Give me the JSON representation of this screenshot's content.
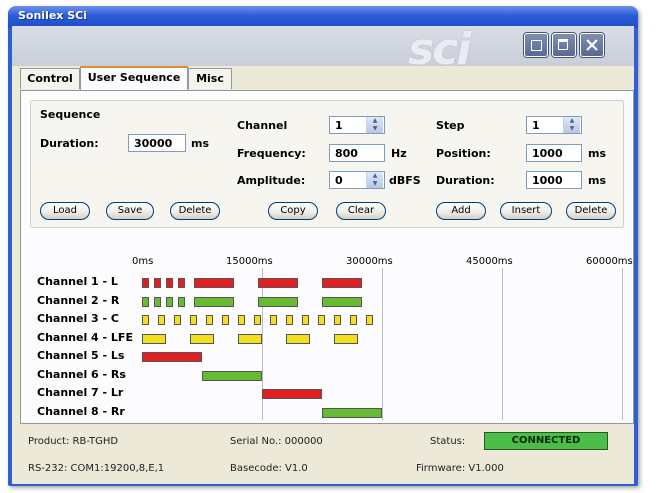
{
  "window": {
    "title": "Sonilex SCi",
    "logo": "sci"
  },
  "window_buttons": [
    {
      "icon": "restore-icon"
    },
    {
      "icon": "minimize-icon"
    },
    {
      "icon": "close-icon"
    }
  ],
  "tabs": [
    {
      "label": "Control",
      "active": false
    },
    {
      "label": "User Sequence",
      "active": true
    },
    {
      "label": "Misc",
      "active": false
    }
  ],
  "sequence": {
    "heading": "Sequence",
    "duration_label": "Duration:",
    "duration_value": "30000",
    "duration_unit": "ms",
    "buttons": [
      "Load",
      "Save",
      "Delete"
    ]
  },
  "channel_panel": {
    "channel_label": "Channel",
    "channel_value": "1",
    "frequency_label": "Frequency:",
    "frequency_value": "800",
    "frequency_unit": "Hz",
    "amplitude_label": "Amplitude:",
    "amplitude_value": "0",
    "amplitude_unit": "dBFS",
    "buttons": [
      "Copy",
      "Clear"
    ]
  },
  "step_panel": {
    "step_label": "Step",
    "step_value": "1",
    "position_label": "Position:",
    "position_value": "1000",
    "position_unit": "ms",
    "duration_label": "Duration:",
    "duration_value": "1000",
    "duration_unit": "ms",
    "buttons": [
      "Add",
      "Insert",
      "Delete"
    ]
  },
  "timeline": {
    "ticks": [
      "0ms",
      "15000ms",
      "30000ms",
      "45000ms",
      "60000ms"
    ],
    "tick_values": [
      0,
      15000,
      30000,
      45000,
      60000
    ],
    "colors": {
      "red": "#e02020",
      "green": "#66bb33",
      "yellow": "#f0e020"
    },
    "channels": [
      {
        "label": "Channel 1 - L",
        "blocks": [
          {
            "start": 0,
            "end": 900,
            "color": "red"
          },
          {
            "start": 1500,
            "end": 2400,
            "color": "red"
          },
          {
            "start": 3000,
            "end": 3900,
            "color": "red"
          },
          {
            "start": 4500,
            "end": 5400,
            "color": "red"
          },
          {
            "start": 6500,
            "end": 11500,
            "color": "red"
          },
          {
            "start": 14500,
            "end": 19500,
            "color": "red"
          },
          {
            "start": 22500,
            "end": 27500,
            "color": "red"
          }
        ]
      },
      {
        "label": "Channel 2 - R",
        "blocks": [
          {
            "start": 0,
            "end": 900,
            "color": "green"
          },
          {
            "start": 1500,
            "end": 2400,
            "color": "green"
          },
          {
            "start": 3000,
            "end": 3900,
            "color": "green"
          },
          {
            "start": 4500,
            "end": 5400,
            "color": "green"
          },
          {
            "start": 6500,
            "end": 11500,
            "color": "green"
          },
          {
            "start": 14500,
            "end": 19500,
            "color": "green"
          },
          {
            "start": 22500,
            "end": 27500,
            "color": "green"
          }
        ]
      },
      {
        "label": "Channel 3 - C",
        "blocks": [
          {
            "start": 0,
            "end": 900,
            "color": "yellow"
          },
          {
            "start": 2000,
            "end": 2900,
            "color": "yellow"
          },
          {
            "start": 4000,
            "end": 4900,
            "color": "yellow"
          },
          {
            "start": 6000,
            "end": 6900,
            "color": "yellow"
          },
          {
            "start": 8000,
            "end": 8900,
            "color": "yellow"
          },
          {
            "start": 10000,
            "end": 10900,
            "color": "yellow"
          },
          {
            "start": 12000,
            "end": 12900,
            "color": "yellow"
          },
          {
            "start": 14000,
            "end": 14900,
            "color": "yellow"
          },
          {
            "start": 16000,
            "end": 16900,
            "color": "yellow"
          },
          {
            "start": 18000,
            "end": 18900,
            "color": "yellow"
          },
          {
            "start": 20000,
            "end": 20900,
            "color": "yellow"
          },
          {
            "start": 22000,
            "end": 22900,
            "color": "yellow"
          },
          {
            "start": 24000,
            "end": 24900,
            "color": "yellow"
          },
          {
            "start": 26000,
            "end": 26900,
            "color": "yellow"
          },
          {
            "start": 28000,
            "end": 28900,
            "color": "yellow"
          }
        ]
      },
      {
        "label": "Channel 4 - LFE",
        "blocks": [
          {
            "start": 0,
            "end": 3000,
            "color": "yellow"
          },
          {
            "start": 6000,
            "end": 9000,
            "color": "yellow"
          },
          {
            "start": 12000,
            "end": 15000,
            "color": "yellow"
          },
          {
            "start": 18000,
            "end": 21000,
            "color": "yellow"
          },
          {
            "start": 24000,
            "end": 27000,
            "color": "yellow"
          }
        ]
      },
      {
        "label": "Channel 5 - Ls",
        "blocks": [
          {
            "start": 0,
            "end": 7500,
            "color": "red"
          }
        ]
      },
      {
        "label": "Channel 6 - Rs",
        "blocks": [
          {
            "start": 7500,
            "end": 15000,
            "color": "green"
          }
        ]
      },
      {
        "label": "Channel 7 - Lr",
        "blocks": [
          {
            "start": 15000,
            "end": 22500,
            "color": "red"
          }
        ]
      },
      {
        "label": "Channel 8 - Rr",
        "blocks": [
          {
            "start": 22500,
            "end": 30000,
            "color": "green"
          }
        ]
      }
    ]
  },
  "statusbar": {
    "product": "Product:  RB-TGHD",
    "serial": "Serial No.:  000000",
    "status_label": "Status:",
    "status_value": "CONNECTED",
    "status_color": "#4cbd48",
    "rs232": "RS-232:  COM1:19200,8,E,1",
    "basecode": "Basecode:  V1.0",
    "firmware": "Firmware:  V1.000"
  }
}
